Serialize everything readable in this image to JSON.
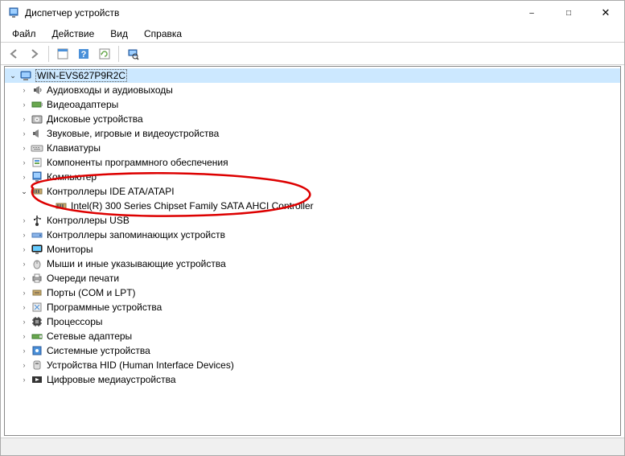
{
  "window": {
    "title": "Диспетчер устройств"
  },
  "menu": {
    "file": "Файл",
    "action": "Действие",
    "view": "Вид",
    "help": "Справка"
  },
  "tree": {
    "root": "WIN-EVS627P9R2C",
    "categories": [
      {
        "key": "audio",
        "label": "Аудиовходы и аудиовыходы",
        "expanded": false
      },
      {
        "key": "video",
        "label": "Видеоадаптеры",
        "expanded": false
      },
      {
        "key": "disk",
        "label": "Дисковые устройства",
        "expanded": false
      },
      {
        "key": "sound",
        "label": "Звуковые, игровые и видеоустройства",
        "expanded": false
      },
      {
        "key": "keyboard",
        "label": "Клавиатуры",
        "expanded": false
      },
      {
        "key": "software",
        "label": "Компоненты программного обеспечения",
        "expanded": false
      },
      {
        "key": "computer",
        "label": "Компьютер",
        "expanded": false
      },
      {
        "key": "ide",
        "label": "Контроллеры IDE ATA/ATAPI",
        "expanded": true,
        "children": [
          {
            "key": "sata",
            "label": "Intel(R) 300 Series Chipset Family SATA AHCI Controller"
          }
        ]
      },
      {
        "key": "usb",
        "label": "Контроллеры USB",
        "expanded": false
      },
      {
        "key": "storage",
        "label": "Контроллеры запоминающих устройств",
        "expanded": false
      },
      {
        "key": "monitor",
        "label": "Мониторы",
        "expanded": false
      },
      {
        "key": "mouse",
        "label": "Мыши и иные указывающие устройства",
        "expanded": false
      },
      {
        "key": "print",
        "label": "Очереди печати",
        "expanded": false
      },
      {
        "key": "ports",
        "label": "Порты (COM и LPT)",
        "expanded": false
      },
      {
        "key": "progdev",
        "label": "Программные устройства",
        "expanded": false
      },
      {
        "key": "cpu",
        "label": "Процессоры",
        "expanded": false
      },
      {
        "key": "network",
        "label": "Сетевые адаптеры",
        "expanded": false
      },
      {
        "key": "system",
        "label": "Системные устройства",
        "expanded": false
      },
      {
        "key": "hid",
        "label": "Устройства HID (Human Interface Devices)",
        "expanded": false
      },
      {
        "key": "media",
        "label": "Цифровые медиаустройства",
        "expanded": false
      }
    ]
  }
}
